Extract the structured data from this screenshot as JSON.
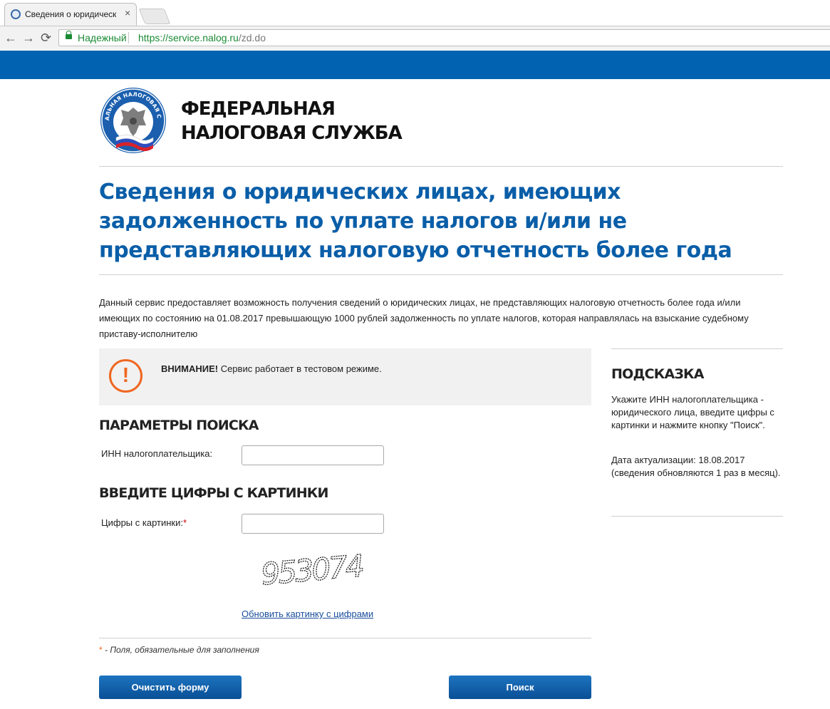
{
  "browser": {
    "tab_title": "Сведения о юридическ",
    "tab_close": "×",
    "back": "←",
    "forward": "→",
    "reload": "⟳",
    "secure_label": "Надежный",
    "url_host": "https://service.nalog.ru",
    "url_path": "/zd.do"
  },
  "header": {
    "logo_text": "ФЕДЕРАЛЬНАЯ НАЛОГОВАЯ СЛУЖБА",
    "org_line1": "ФЕДЕРАЛЬНАЯ",
    "org_line2": "НАЛОГОВАЯ СЛУЖБА"
  },
  "page": {
    "title": "Сведения о юридических лицах, имеющих задолженность по уплате налогов и/или не представляющих налоговую отчетность более года",
    "description": "Данный сервис предоставляет возможность получения сведений о юридических лицах, не представляющих налоговую отчетность более года и/или имеющих по состоянию на 01.08.2017 превышающую 1000 рублей задолженность по уплате налогов, которая направлялась на взыскание судебному приставу-исполнителю"
  },
  "warning": {
    "icon": "!",
    "bold": "ВНИМАНИЕ!",
    "text": " Сервис работает в тестовом режиме."
  },
  "search": {
    "heading": "ПАРАМЕТРЫ ПОИСКА",
    "inn_label": "ИНН налогоплательщика:",
    "inn_value": ""
  },
  "captcha": {
    "heading": "ВВЕДИТЕ ЦИФРЫ С КАРТИНКИ",
    "label": "Цифры с картинки:",
    "required_mark": "*",
    "value": "",
    "image_text": "953074",
    "refresh_link": "Обновить картинку с цифрами"
  },
  "footer": {
    "star": "*",
    "note": " - Поля, обязательные для заполнения",
    "clear_button": "Очистить форму",
    "search_button": "Поиск"
  },
  "hint": {
    "title": "ПОДСКАЗКА",
    "text": "Укажите ИНН налогоплательщика - юридического лица, введите цифры с картинки и нажмите кнопку \"Поиск\".",
    "update": "Дата актуализации: 18.08.2017 (сведения обновляются 1 раз в месяц)."
  },
  "colors": {
    "brand_blue": "#0062b1",
    "title_blue": "#0a5ea8",
    "warning_orange": "#f0661f",
    "secure_green": "#1a8a34"
  }
}
